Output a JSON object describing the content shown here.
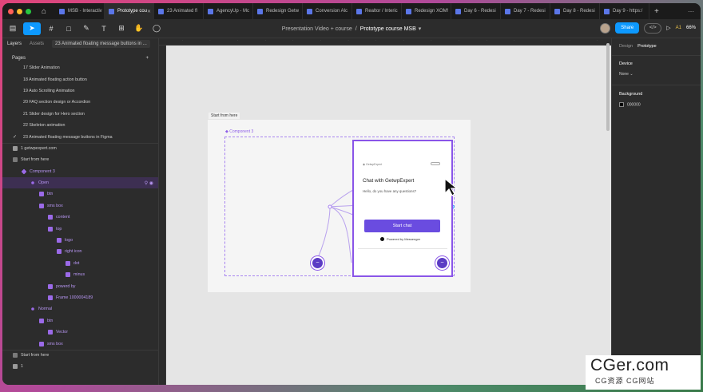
{
  "tabs": [
    {
      "label": "MSB - Interactiv",
      "active": false
    },
    {
      "label": "Prototype cou",
      "active": true
    },
    {
      "label": "23 Animated fl",
      "active": false
    },
    {
      "label": "AgencyUp - Mc",
      "active": false
    },
    {
      "label": "Redesign Getw",
      "active": false
    },
    {
      "label": "Conversion Alc",
      "active": false
    },
    {
      "label": "Realtor / Interic",
      "active": false
    },
    {
      "label": "Redesign XOM!",
      "active": false
    },
    {
      "label": "Day 6 - Redesi",
      "active": false
    },
    {
      "label": "Day 7 - Redesi",
      "active": false
    },
    {
      "label": "Day 8 - Redesi",
      "active": false
    },
    {
      "label": "Day 9 - https:/",
      "active": false
    }
  ],
  "toolbar": {
    "project": "Presentation Video + course",
    "separator": "/",
    "file": "Prototype course MSB",
    "share": "Share",
    "zoom": "66%",
    "present_icon": "play-icon",
    "ai_label": "A1"
  },
  "left_panel": {
    "tab_layers": "Layers",
    "tab_assets": "Assets",
    "page_selector": "23 Animated floating message buttons in ...",
    "pages_label": "Pages",
    "pages": [
      "17 Slider Animation",
      "18 Animated floating action button",
      "19 Auto Scrolling Animation",
      "20 FAQ section design or Accordion",
      "21 Slider design for Hero section",
      "22 Skeleton animation",
      "23 Animated floating message buttons in Figma"
    ],
    "layers": [
      {
        "label": "1 getwpexpert.com",
        "indent": 0,
        "icon": "grid",
        "hl": false,
        "purple": false
      },
      {
        "label": "Start from here",
        "indent": 0,
        "icon": "frame",
        "hl": false,
        "purple": false
      },
      {
        "label": "Component 3",
        "indent": 1,
        "icon": "component",
        "hl": false,
        "purple": true
      },
      {
        "label": "Open",
        "indent": 2,
        "icon": "variant",
        "hl": true,
        "purple": true
      },
      {
        "label": "btn",
        "indent": 3,
        "icon": "frame",
        "hl": false,
        "purple": true
      },
      {
        "label": "sms box",
        "indent": 3,
        "icon": "frame",
        "hl": false,
        "purple": true
      },
      {
        "label": "content",
        "indent": 4,
        "icon": "frame",
        "hl": false,
        "purple": true
      },
      {
        "label": "top",
        "indent": 4,
        "icon": "frame",
        "hl": false,
        "purple": true
      },
      {
        "label": "logo",
        "indent": 5,
        "icon": "frame",
        "hl": false,
        "purple": true
      },
      {
        "label": "right icon",
        "indent": 5,
        "icon": "frame",
        "hl": false,
        "purple": true
      },
      {
        "label": "dot",
        "indent": 6,
        "icon": "frame",
        "hl": false,
        "purple": true
      },
      {
        "label": "minus",
        "indent": 6,
        "icon": "frame",
        "hl": false,
        "purple": true
      },
      {
        "label": "powerd by",
        "indent": 4,
        "icon": "frame",
        "hl": false,
        "purple": true
      },
      {
        "label": "Frame 1000004189",
        "indent": 4,
        "icon": "frame",
        "hl": false,
        "purple": true
      },
      {
        "label": "Normal",
        "indent": 2,
        "icon": "variant",
        "hl": false,
        "purple": true
      },
      {
        "label": "btn",
        "indent": 3,
        "icon": "frame",
        "hl": false,
        "purple": true
      },
      {
        "label": "Vector",
        "indent": 4,
        "icon": "vector",
        "hl": false,
        "purple": true
      },
      {
        "label": "sms box",
        "indent": 3,
        "icon": "frame",
        "hl": false,
        "purple": true
      },
      {
        "label": "Start from here",
        "indent": 0,
        "icon": "frame",
        "hl": false,
        "purple": false
      },
      {
        "label": "1",
        "indent": 0,
        "icon": "grid",
        "hl": false,
        "purple": false
      }
    ]
  },
  "canvas": {
    "frame_label": "Start from here",
    "component_label": "Component 3",
    "chat_brand": "GetwpExpert",
    "chat_title": "Chat with GetwpExpert",
    "chat_subtitle": "Hello, do you have any questions?",
    "start_button": "Start chat",
    "powered_by": "Powered by Messenger",
    "messenger_glyph": "~"
  },
  "right_panel": {
    "tab_design": "Design",
    "tab_prototype": "Prototype",
    "device_label": "Device",
    "device_value": "None",
    "background_label": "Background",
    "background_value": "000000",
    "background_color": "#000000"
  },
  "watermark": {
    "big": "CGer.com",
    "small": "CG资源 CG网站"
  },
  "colors": {
    "accent": "#0d99ff",
    "component": "#8a55e8",
    "start_button": "#6a4ce0"
  }
}
